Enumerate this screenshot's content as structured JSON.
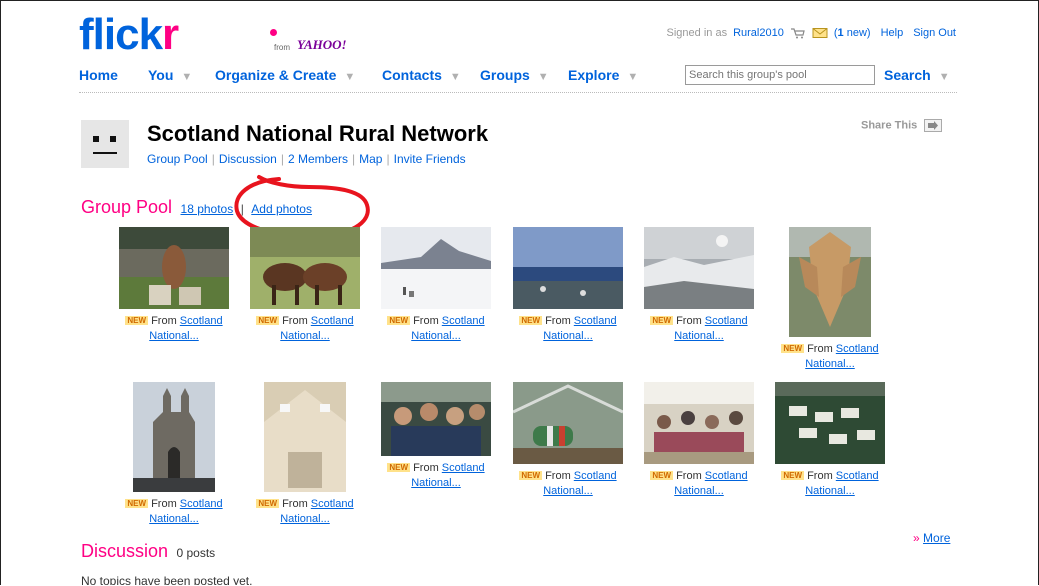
{
  "header": {
    "logo_main": "flickr",
    "logo_from": "from",
    "logo_yahoo": "YAHOO!",
    "signed_in_prefix": "Signed in as",
    "username": "Rural2010",
    "mail_count": "1",
    "mail_suffix": "new",
    "help": "Help",
    "sign_out": "Sign Out"
  },
  "nav": {
    "home": "Home",
    "you": "You",
    "organize": "Organize & Create",
    "contacts": "Contacts",
    "groups": "Groups",
    "explore": "Explore",
    "search_placeholder": "Search this group's pool",
    "search_button": "Search"
  },
  "group": {
    "title": "Scotland National Rural Network",
    "links": [
      "Group Pool",
      "Discussion",
      "2 Members",
      "Map",
      "Invite Friends"
    ],
    "share": "Share This"
  },
  "pool": {
    "title": "Group Pool",
    "count": "18 photos",
    "separator": "|",
    "add": "Add photos",
    "photos": [
      {
        "new": "NEW",
        "from": "From",
        "link1": "Scotland",
        "link2": "National..."
      },
      {
        "new": "NEW",
        "from": "From",
        "link1": "Scotland",
        "link2": "National..."
      },
      {
        "new": "NEW",
        "from": "From",
        "link1": "Scotland",
        "link2": "National..."
      },
      {
        "new": "NEW",
        "from": "From",
        "link1": "Scotland",
        "link2": "National..."
      },
      {
        "new": "NEW",
        "from": "From",
        "link1": "Scotland",
        "link2": "National..."
      },
      {
        "new": "NEW",
        "from": "From",
        "link1": "Scotland",
        "link2": "National..."
      },
      {
        "new": "NEW",
        "from": "From",
        "link1": "Scotland",
        "link2": "National..."
      },
      {
        "new": "NEW",
        "from": "From",
        "link1": "Scotland",
        "link2": "National..."
      },
      {
        "new": "NEW",
        "from": "From",
        "link1": "Scotland",
        "link2": "National..."
      },
      {
        "new": "NEW",
        "from": "From",
        "link1": "Scotland",
        "link2": "National..."
      },
      {
        "new": "NEW",
        "from": "From",
        "link1": "Scotland",
        "link2": "National..."
      },
      {
        "new": "NEW",
        "from": "From",
        "link1": "Scotland",
        "link2": "National..."
      }
    ],
    "more_arrow": "»",
    "more": "More"
  },
  "discussion": {
    "title": "Discussion",
    "count": "0 posts",
    "empty_text": "No topics have been posted yet."
  },
  "colors": {
    "link": "#0063dc",
    "pink": "#ff0084",
    "annotation": "#e8141e"
  }
}
